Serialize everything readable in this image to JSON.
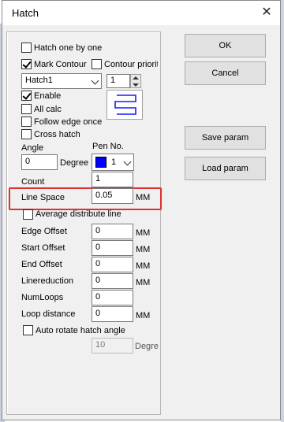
{
  "window": {
    "title": "Hatch",
    "close_glyph": "✕"
  },
  "options": {
    "hatch_one_by_one": {
      "label": "Hatch one by one",
      "checked": false
    },
    "mark_contour": {
      "label": "Mark Contour",
      "checked": true
    },
    "contour_priority": {
      "label": "Contour priorit",
      "checked": false
    },
    "hatch_select": {
      "value": "Hatch1"
    },
    "hatch_count_spin": {
      "value": "1"
    },
    "enable": {
      "label": "Enable",
      "checked": true
    },
    "all_calc": {
      "label": "All calc",
      "checked": false
    },
    "follow_edge_once": {
      "label": "Follow edge once",
      "checked": false
    },
    "cross_hatch": {
      "label": "Cross hatch",
      "checked": false
    },
    "average_distribute_line": {
      "label": "Average distribute line",
      "checked": false
    },
    "auto_rotate": {
      "label": "Auto rotate hatch angle",
      "checked": false
    }
  },
  "angle": {
    "label": "Angle",
    "value": "0",
    "unit": "Degree"
  },
  "pen": {
    "label": "Pen No.",
    "value": "1",
    "color": "#0000ff"
  },
  "count": {
    "label": "Count",
    "value": "1"
  },
  "line_space": {
    "label": "Line Space",
    "value": "0.05",
    "unit": "MM"
  },
  "fields": {
    "edge_offset": {
      "label": "Edge Offset",
      "value": "0",
      "unit": "MM"
    },
    "start_offset": {
      "label": "Start Offset",
      "value": "0",
      "unit": "MM"
    },
    "end_offset": {
      "label": "End Offset",
      "value": "0",
      "unit": "MM"
    },
    "linereduction": {
      "label": "Linereduction",
      "value": "0",
      "unit": "MM"
    },
    "num_loops": {
      "label": "NumLoops",
      "value": "0"
    },
    "loop_distance": {
      "label": "Loop distance",
      "value": "0",
      "unit": "MM"
    }
  },
  "rotate_angle": {
    "value": "10",
    "unit": "Degre"
  },
  "buttons": {
    "ok": "OK",
    "cancel": "Cancel",
    "save_param": "Save param",
    "load_param": "Load param"
  },
  "annotation": {
    "highlight_color": "#e03030"
  },
  "icons": {
    "pattern_preview": "serpentine-hatch-icon",
    "close": "close-icon",
    "chevron": "chevron-down-icon"
  }
}
